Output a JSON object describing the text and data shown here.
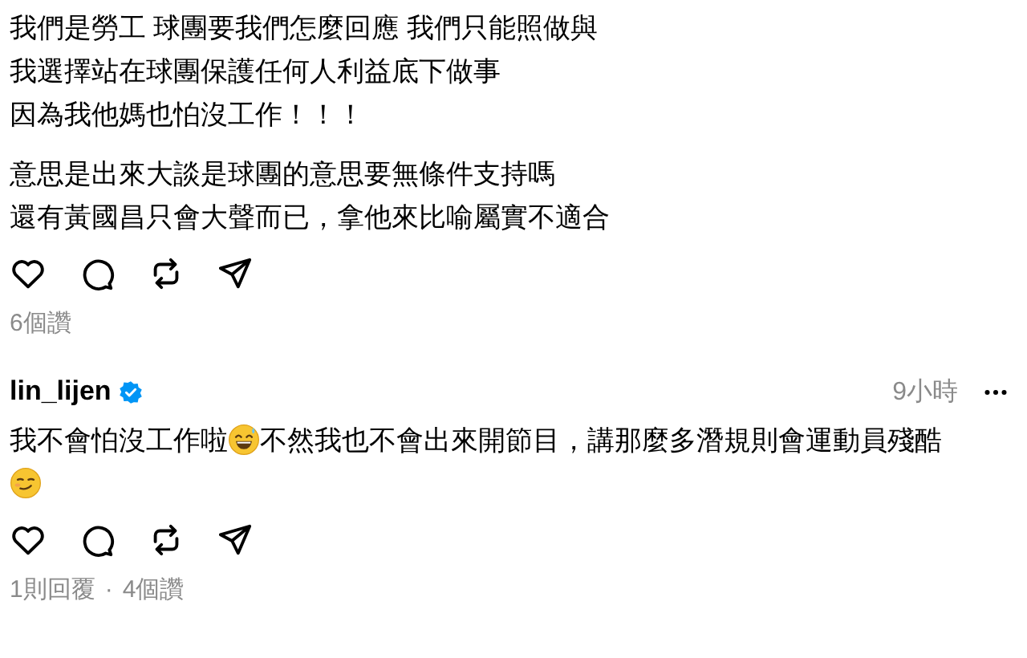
{
  "post": {
    "paragraphs": [
      [
        "我們是勞工 球團要我們怎麼回應 我們只能照做與",
        "我選擇站在球團保護任何人利益底下做事",
        "因為我他媽也怕沒工作！！！"
      ],
      [
        "意思是出來大談是球團的意思要無條件支持嗎",
        "還有黃國昌只會大聲而已，拿他來比喻屬實不適合"
      ]
    ],
    "likes": "6個讚"
  },
  "reply": {
    "username": "lin_lijen",
    "verified": true,
    "time": "9小時",
    "segments": [
      {
        "kind": "text",
        "text": "我不會怕沒工作啦"
      },
      {
        "kind": "sweat-smile"
      },
      {
        "kind": "text",
        "text": "不然我也不會出來開節目，講那麼多潛規則會運動員殘酷"
      },
      {
        "kind": "smirk"
      }
    ],
    "stats": [
      "1則回覆",
      "4個讚"
    ],
    "separator": "·"
  }
}
